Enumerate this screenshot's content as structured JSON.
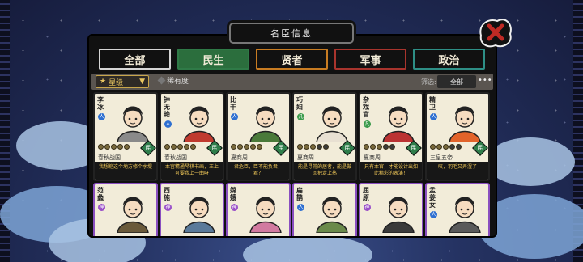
{
  "window": {
    "title": "名臣信息"
  },
  "tabs": [
    "全部",
    "民生",
    "贤者",
    "军事",
    "政治"
  ],
  "filter": {
    "rarity_label": "星级",
    "rarity_sort_label": "稀有度",
    "sort_label": "筛选:",
    "sort_value": "全部",
    "more": "•••"
  },
  "cards": [
    {
      "name": "李冰",
      "age": "人",
      "era": "春秋战国",
      "badge": "民",
      "stars": 5,
      "quote": "我想挖这个地方修个水堤",
      "color": "#8a8a8a"
    },
    {
      "name": "钟无艳",
      "age": "人",
      "era": "春秋战国",
      "badge": "民",
      "stars": 5,
      "quote": "本宫精通琴棋书画，王上可要我上一曲呀",
      "color": "#c03a2f"
    },
    {
      "name": "比干",
      "age": "人",
      "era": "夏商周",
      "badge": "民",
      "stars": 5,
      "quote": "君危臣，臣不能负君，君？",
      "color": "#4a7a3a"
    },
    {
      "name": "巧妇",
      "age": "凡",
      "era": "夏商周",
      "badge": "民",
      "stars": 3,
      "quote": "能是寻常的居者，能是做回把走上热",
      "color": "#e8e0d2"
    },
    {
      "name": "杂戏官",
      "age": "凡",
      "era": "夏商周",
      "badge": "民",
      "stars": 3,
      "quote": "只有本官，才能设计出如此精彩的表演！",
      "color": "#b33"
    },
    {
      "name": "精卫",
      "age": "人",
      "era": "三皇五帝",
      "badge": "民",
      "stars": 3,
      "quote": "叹，羽毛又弄湿了",
      "color": "#e2632a"
    },
    {
      "name": "范蠡",
      "age": "神",
      "color": "#6a5a3a"
    },
    {
      "name": "西施",
      "age": "神",
      "color": "#5a7a9a"
    },
    {
      "name": "嫦娥",
      "age": "神",
      "color": "#d27aa0"
    },
    {
      "name": "扁鹊",
      "age": "人",
      "color": "#6a8a4a"
    },
    {
      "name": "屈原",
      "age": "神",
      "color": "#3a3a3a"
    },
    {
      "name": "孟姜女",
      "age": "人",
      "color": "#5a5a5a"
    }
  ]
}
